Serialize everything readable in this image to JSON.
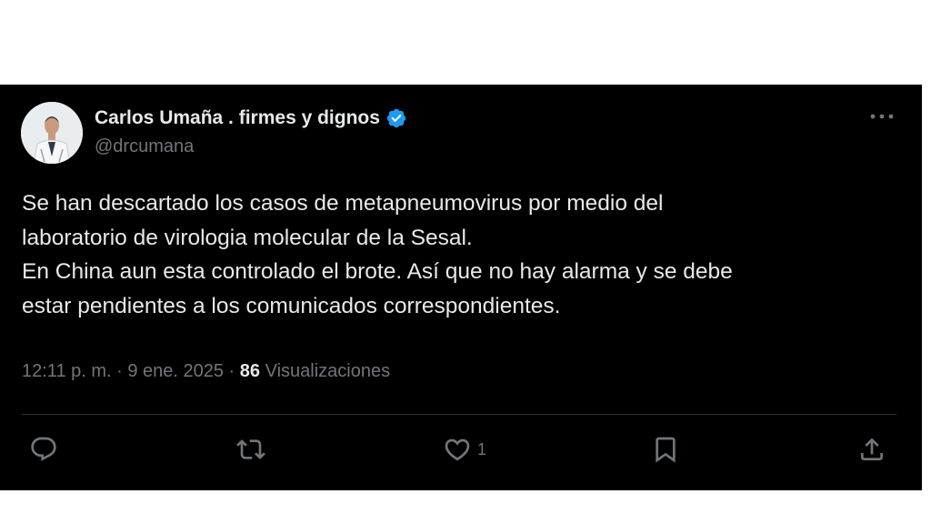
{
  "tweet": {
    "author_name": "Carlos Umaña . firmes y dignos",
    "handle": "@drcumana",
    "verified": true,
    "body_lines": [
      "Se han descartado los casos de metapneumovirus por medio del",
      "laboratorio de virologia molecular de la Sesal.",
      "En China aun esta controlado el brote. Así que no hay alarma y se debe",
      "estar pendientes a los comunicados correspondientes."
    ],
    "timestamp": "12:11 p. m. · 9 ene. 2025 · ",
    "views_count": "86",
    "views_label": " Visualizaciones",
    "likes_count": "1"
  },
  "icons": {
    "more": "more-horizontal-icon",
    "reply": "reply-icon",
    "retweet": "retweet-icon",
    "like": "heart-icon",
    "bookmark": "bookmark-icon",
    "share": "share-icon",
    "verified": "verified-badge-icon"
  },
  "colors": {
    "background": "#000000",
    "text_primary": "#e7e9ea",
    "text_secondary": "#71767b",
    "verified_blue": "#1d9bf0",
    "divider": "#2f3336"
  }
}
